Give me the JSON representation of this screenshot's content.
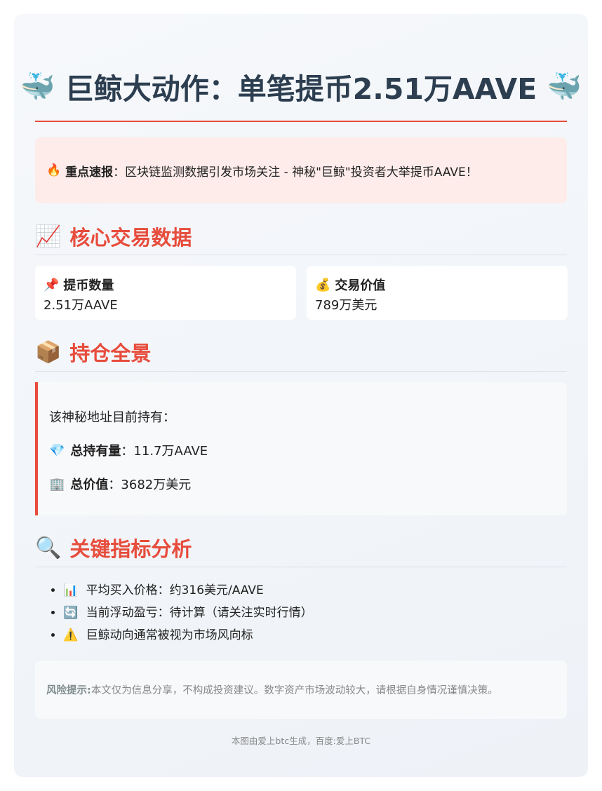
{
  "header": {
    "title": "巨鲸大动作：单笔提币2.51万AAVE",
    "left_icon": "whale-icon",
    "right_icon": "whale-icon"
  },
  "alert": {
    "icon": "fire-icon",
    "label": "重点速报",
    "separator": "：",
    "text": "区块链监测数据引发市场关注 - 神秘\"巨鲸\"投资者大举提币AAVE！"
  },
  "sections": {
    "core": {
      "icon": "chart-up-icon",
      "title": "核心交易数据"
    },
    "holdings": {
      "icon": "package-icon",
      "title": "持仓全景"
    },
    "metrics": {
      "icon": "magnifier-icon",
      "title": "关键指标分析"
    }
  },
  "stats": [
    {
      "icon": "pushpin-icon",
      "label": "提币数量",
      "value": "2.51万AAVE"
    },
    {
      "icon": "money-bag-icon",
      "label": "交易价值",
      "value": "789万美元"
    }
  ],
  "holdings": {
    "intro": "该神秘地址目前持有：",
    "total_amount": {
      "icon": "diamond-icon",
      "label": "总持有量",
      "value": "11.7万AAVE"
    },
    "total_value": {
      "icon": "building-icon",
      "label": "总价值",
      "value": "3682万美元"
    }
  },
  "metrics": [
    {
      "icon": "bar-chart-icon",
      "text": "平均买入价格：约316美元/AAVE"
    },
    {
      "icon": "refresh-icon",
      "text": "当前浮动盈亏：待计算（请关注实时行情）"
    },
    {
      "icon": "warning-icon",
      "text": "巨鲸动向通常被视为市场风向标"
    }
  ],
  "risk": {
    "label": "风险提示:",
    "text": "本文仅为信息分享，不构成投资建议。数字资产市场波动较大，请根据自身情况谨慎决策。"
  },
  "footer": "本图由爱上btc生成，百度:爱上BTC",
  "colors": {
    "accent": "#e74c3c",
    "title": "#2c3e50",
    "alert_bg": "#fdecea"
  }
}
